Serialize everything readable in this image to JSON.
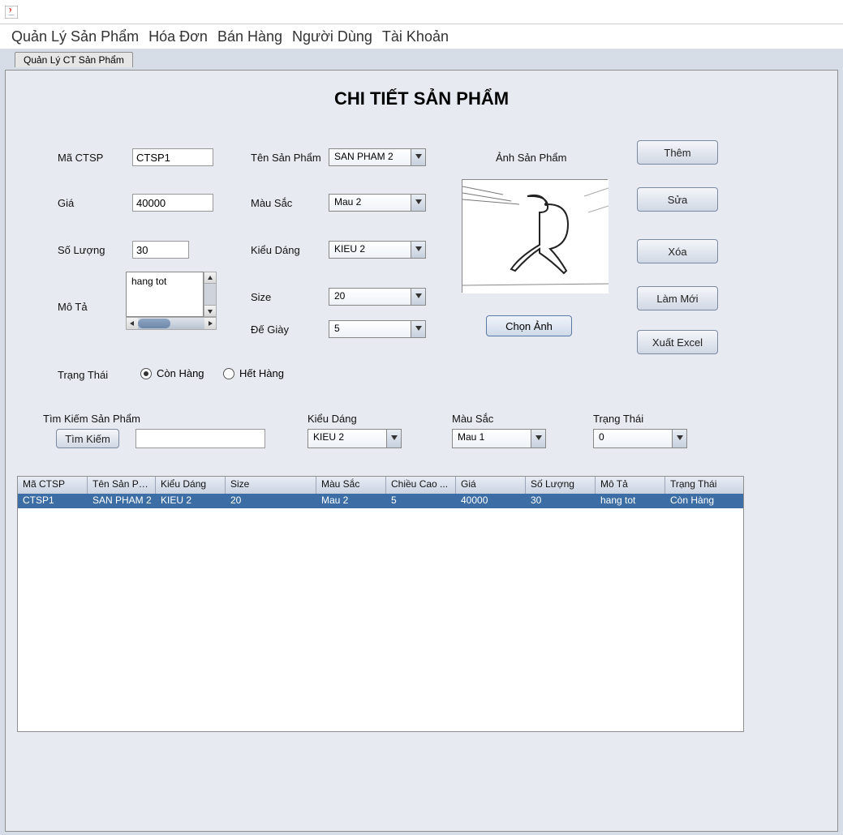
{
  "menubar": {
    "items": [
      "Quản Lý Sản Phẩm",
      "Hóa Đơn",
      "Bán Hàng",
      "Người Dùng",
      "Tài Khoản"
    ]
  },
  "tab": {
    "label": "Quản Lý CT Sản Phẩm"
  },
  "title": "CHI TIẾT SẢN PHẨM",
  "labels": {
    "ma_ctsp": "Mã CTSP",
    "gia": "Giá",
    "so_luong": "Số Lượng",
    "mo_ta": "Mô Tả",
    "trang_thai": "Trạng Thái",
    "ten_sp": "Tên Sản Phẩm",
    "mau_sac": "Màu Sắc",
    "kieu_dang": "Kiểu Dáng",
    "size": "Size",
    "de_giay": "Đế Giày",
    "anh_sp": "Ảnh Sản Phẩm"
  },
  "values": {
    "ma_ctsp": "CTSP1",
    "gia": "40000",
    "so_luong": "30",
    "mo_ta": "hang tot",
    "ten_sp": "SAN PHAM 2",
    "mau_sac": "Mau 2",
    "kieu_dang": "KIEU 2",
    "size": "20",
    "de_giay": "5"
  },
  "radios": {
    "con_hang": "Còn Hàng",
    "het_hang": "Hết Hàng"
  },
  "buttons": {
    "them": "Thêm",
    "sua": "Sửa",
    "xoa": "Xóa",
    "lam_moi": "Làm Mới",
    "xuat_excel": "Xuất Excel",
    "chon_anh": "Chọn Ảnh",
    "tim_kiem": "Tìm Kiếm"
  },
  "search": {
    "label_tim": "Tìm Kiếm Sản Phẩm",
    "label_kieu": "Kiểu Dáng",
    "label_mau": "Màu Sắc",
    "label_tt": "Trạng Thái",
    "sel_kieu": "KIEU 2",
    "sel_mau": "Mau 1",
    "sel_tt": "0"
  },
  "table": {
    "headers": [
      "Mã CTSP",
      "Tên Sản Ph...",
      "Kiểu Dáng",
      "Size",
      "Màu Sắc",
      "Chiều Cao ...",
      "Giá",
      "Số Lượng",
      "Mô Tả",
      "Trạng Thái"
    ],
    "rows": [
      [
        "CTSP1",
        "SAN PHAM 2",
        "KIEU 2",
        "20",
        "Mau 2",
        "5",
        "40000",
        "30",
        "hang tot",
        "Còn Hàng"
      ]
    ]
  }
}
